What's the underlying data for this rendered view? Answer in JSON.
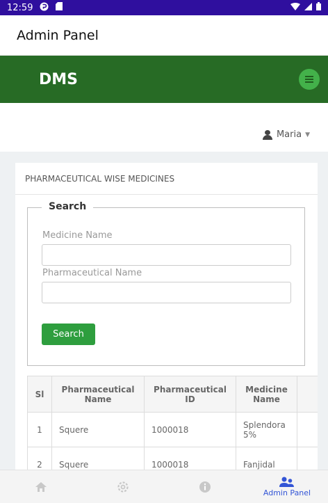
{
  "status_bar": {
    "time": "12:59"
  },
  "app_bar": {
    "title": "Admin Panel"
  },
  "brand": {
    "title": "DMS"
  },
  "user": {
    "name": "Maria"
  },
  "panel": {
    "heading": "PHARMACEUTICAL WISE MEDICINES",
    "search": {
      "legend": "Search",
      "medicine_label": "Medicine Name",
      "medicine_value": "",
      "pharma_label": "Pharmaceutical Name",
      "pharma_value": "",
      "button_label": "Search"
    }
  },
  "table": {
    "headers": [
      "Sl",
      "Pharmaceutical Name",
      "Pharmaceutical ID",
      "Medicine Name",
      ""
    ],
    "rows": [
      [
        "1",
        "Squere",
        "1000018",
        "Splendora 5%",
        ""
      ],
      [
        "2",
        "Squere",
        "1000018",
        "Fanjidal",
        ""
      ]
    ]
  },
  "bottom_nav": {
    "items": [
      {
        "icon": "home-icon",
        "label": ""
      },
      {
        "icon": "settings-icon",
        "label": ""
      },
      {
        "icon": "info-icon",
        "label": ""
      },
      {
        "icon": "users-icon",
        "label": "Admin Panel"
      }
    ]
  },
  "colors": {
    "status_bar": "#2f0f9e",
    "brand_bar": "#276b25",
    "accent_green": "#2e9e3e",
    "nav_active": "#3355d6"
  }
}
